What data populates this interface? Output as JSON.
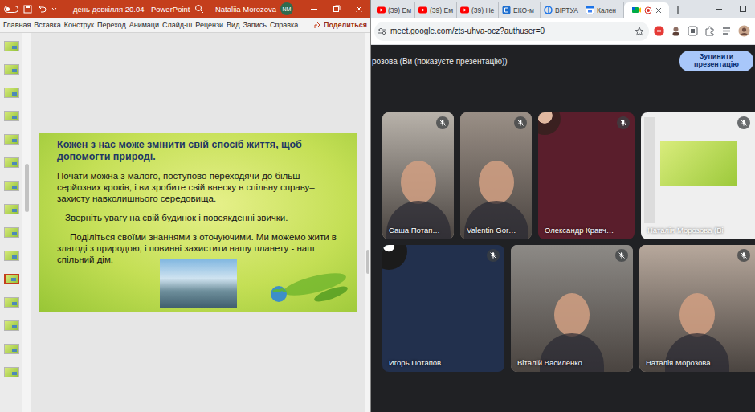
{
  "powerpoint": {
    "title": "день довкілля 20.04  -  PowerPoint",
    "user": "Nataliia Morozova",
    "avatar": "NM",
    "ribbon_tabs": [
      "Главная",
      "Вставка",
      "Конструк",
      "Переход",
      "Анимаци",
      "Слайд-ш",
      "Рецензи",
      "Вид",
      "Запись",
      "Справка"
    ],
    "share": "Поделиться",
    "thumbnails": [
      {
        "selected": false
      },
      {
        "selected": false
      },
      {
        "selected": false
      },
      {
        "selected": false
      },
      {
        "selected": false
      },
      {
        "selected": false
      },
      {
        "selected": false
      },
      {
        "selected": false
      },
      {
        "selected": false
      },
      {
        "selected": false
      },
      {
        "selected": true
      },
      {
        "selected": false
      },
      {
        "selected": false
      },
      {
        "selected": false
      },
      {
        "selected": false
      }
    ],
    "slide": {
      "heading": "Кожен з нас може змінити свій спосіб життя, щоб допомогти природі.",
      "paragraphs": [
        "Почати можна з малого, поступово переходячи до більш серйозних кроків, і ви зробите свій внеску в спільну справу– захисту навколишнього середовища.",
        "Зверніть увагу на свій будинок і повсякденні звички.",
        "Поділіться своїми знаннями з оточуючими. Ми можемо жити в злагоді з природою, і повинні захистити нашу планету - наш спільний дім."
      ]
    }
  },
  "browser": {
    "tabs": [
      {
        "label": "(39) Ем",
        "kind": "youtube",
        "selected": false
      },
      {
        "label": "(39) Ем",
        "kind": "youtube",
        "selected": false
      },
      {
        "label": "(39) Не",
        "kind": "youtube",
        "selected": false
      },
      {
        "label": "ЕКО-м",
        "kind": "eco",
        "selected": false
      },
      {
        "label": "ВІРТУА",
        "kind": "globe",
        "selected": false
      },
      {
        "label": "Кален",
        "kind": "calendar",
        "selected": false
      },
      {
        "kind": "meet",
        "selected": true
      }
    ],
    "url": "meet.google.com/zts-uhva-ocz?authuser=0"
  },
  "meet": {
    "banner": "розова (Ви (показуєте презентацію))",
    "stop_button": "Зупинити презентацію",
    "rows": [
      [
        {
          "name": "Саша Потап…",
          "kind": "video",
          "muted": true,
          "color": "#b8b2aa"
        },
        {
          "name": "Valentin Gor…",
          "kind": "video",
          "muted": true,
          "color": "#9a8f86"
        },
        {
          "name": "Олександр Кравч…",
          "kind": "avatar",
          "muted": true,
          "color": "#5a1e2c"
        },
        {
          "name": "Наталія Морозова (Ві",
          "kind": "screen",
          "muted": true,
          "color": "#efefef"
        }
      ],
      [
        {
          "name": "Игорь Потапов",
          "kind": "avatar",
          "muted": true,
          "color": "#22304d"
        },
        {
          "name": "Віталій Василенко",
          "kind": "video",
          "muted": true,
          "color": "#8d8a86"
        },
        {
          "name": "Наталія Морозова",
          "kind": "video",
          "muted": true,
          "color": "#b7a89c"
        }
      ]
    ]
  }
}
